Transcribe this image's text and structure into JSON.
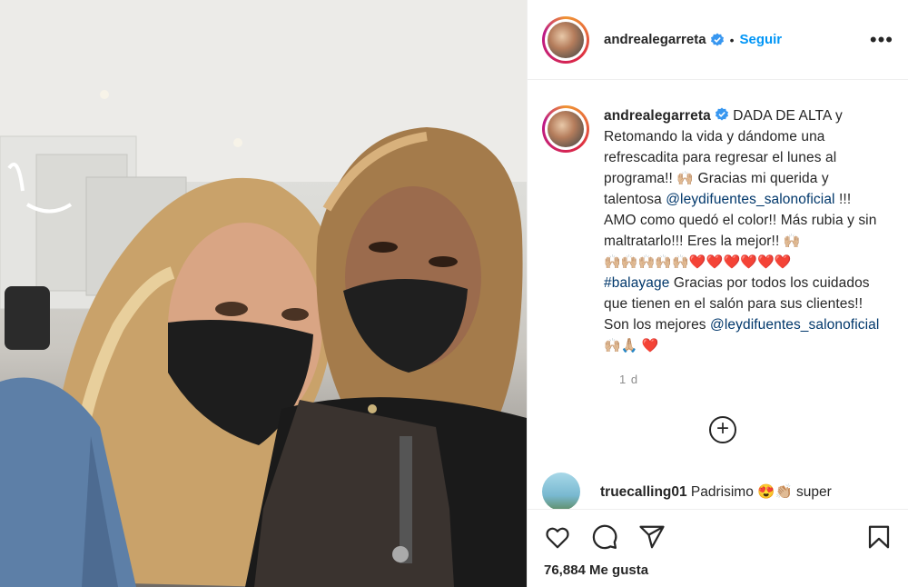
{
  "post": {
    "username": "andrealegarreta",
    "follow_label": "Seguir",
    "more_label": "•••",
    "dot": "•"
  },
  "caption": {
    "username": "andrealegarreta",
    "part1": "DADA DE ALTA y Retomando la vida y dándome una refrescadita para regresar el lunes al programa!! ",
    "emoji1": "🙌🏼",
    "part2": " Gracias mi querida y talentosa ",
    "mention1": "@leydifuentes_salonoficial",
    "part3": " !!! AMO como quedó el color!! Más rubia y sin maltratarlo!!! Eres la mejor!! ",
    "emoji2": "🙌🏼",
    "emoji_row_hands": "🙌🏼🙌🏼🙌🏼🙌🏼🙌🏼",
    "emoji_row_hearts": "❤️❤️❤️❤️❤️❤️",
    "hashtag": "#balayage",
    "part4": " Gracias por todos los cuidados que tienen en el salón para sus clientes!! Son los mejores ",
    "mention2": "@leydifuentes_salonoficial",
    "emoji_end": " 🙌🏼🙏🏼 ",
    "emoji_end_heart": "❤️"
  },
  "timestamp": "1 d",
  "load_more_label": "+",
  "comment": {
    "username": "truecalling01",
    "text": " Padrisimo 😍👏🏼 super"
  },
  "likes": {
    "count_text": "76,884 Me gusta"
  },
  "colors": {
    "accent": "#0095f6",
    "link": "#00376b",
    "heart": "#e0245e",
    "muted": "#8e8e8e"
  },
  "icons": [
    "verified-icon",
    "more-icon",
    "like-icon",
    "comment-icon",
    "share-icon",
    "save-icon",
    "load-more-icon"
  ]
}
